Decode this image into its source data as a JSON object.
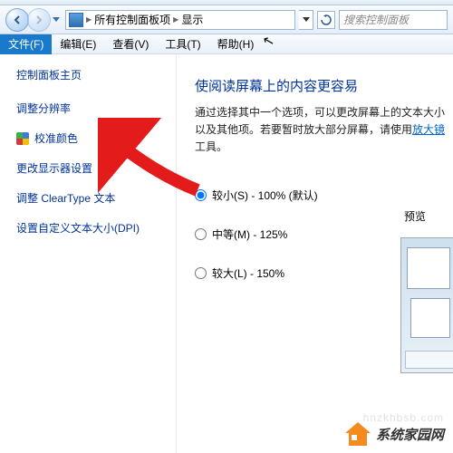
{
  "breadcrumb": {
    "root_icon": "control-panel-icon",
    "item1": "所有控制面板项",
    "item2": "显示"
  },
  "search": {
    "placeholder": "搜索控制面板"
  },
  "menu": {
    "file": "文件(F)",
    "edit": "编辑(E)",
    "view": "查看(V)",
    "tools": "工具(T)",
    "help": "帮助(H)"
  },
  "sidebar": {
    "heading": "控制面板主页",
    "links": {
      "resolution": "调整分辨率",
      "calibrate": "校准颜色",
      "monitor": "更改显示器设置",
      "cleartype": "调整 ClearType 文本",
      "dpi": "设置自定义文本大小(DPI)"
    }
  },
  "content": {
    "title": "使阅读屏幕上的内容更容易",
    "desc_part1": "通过选择其中一个选项，可以更改屏幕上的文本大小以及其他项。若要暂时放大部分屏幕，请使用",
    "magnifier": "放大镜",
    "desc_part2": "工具。",
    "preview_label": "预览",
    "options": {
      "small": "较小(S) - 100% (默认)",
      "medium": "中等(M) - 125%",
      "large": "较大(L) - 150%"
    }
  },
  "watermark": {
    "url": "hnzkhbsb.com",
    "brand": "系统家园网"
  }
}
